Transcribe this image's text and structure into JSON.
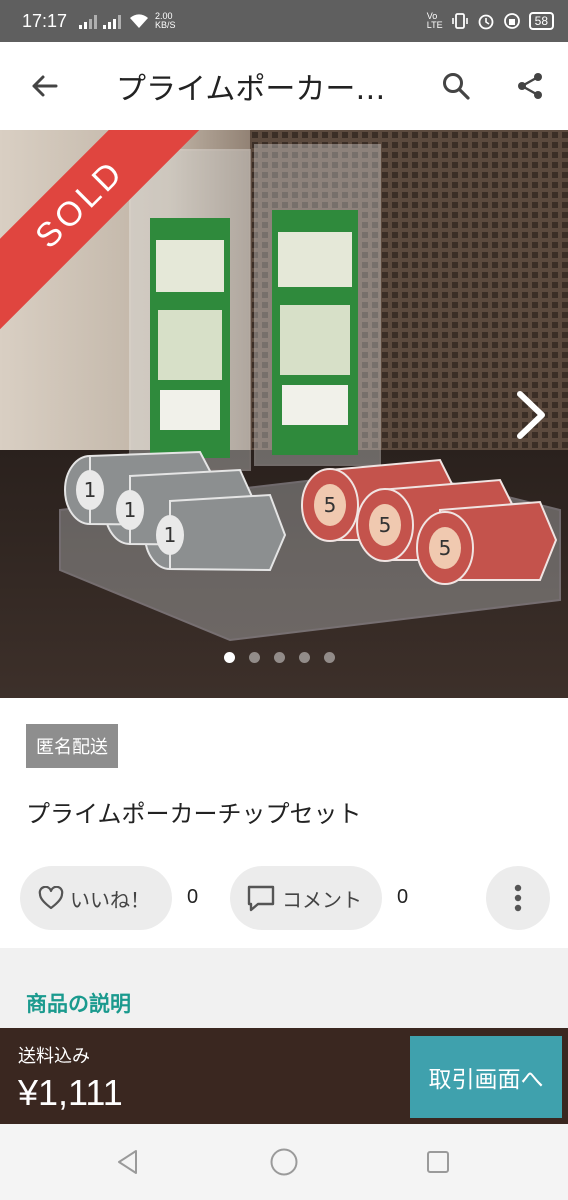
{
  "status_bar": {
    "time": "17:17",
    "net_speed_value": "2.00",
    "net_speed_unit": "KB/S",
    "volte_top": "Vo",
    "volte_bottom": "LTE",
    "battery": "58"
  },
  "header": {
    "title": "プライムポーカー…"
  },
  "photo": {
    "sold_label": "SOLD",
    "page_count": 5,
    "current_page": 1
  },
  "product": {
    "shipping_badge": "匿名配送",
    "title": "プライムポーカーチップセット",
    "like_label": "いいね！",
    "like_count": "0",
    "comment_label": "コメント",
    "comment_count": "0"
  },
  "description": {
    "heading": "商品の説明"
  },
  "purchase_bar": {
    "shipping_label": "送料込み",
    "price": "¥1,111",
    "button_label": "取引画面へ"
  },
  "colors": {
    "status_bar": "#5f5f5f",
    "sold_banner": "#e0453f",
    "accent_teal": "#1a9a8e",
    "buy_bar": "#3a2720",
    "trade_button": "#3fa1ad",
    "badge": "#8e8e8e"
  },
  "icons": {
    "back": "arrow-left-icon",
    "search": "search-icon",
    "share": "share-icon",
    "next": "chevron-right-icon",
    "like": "heart-icon",
    "comment": "comment-icon",
    "more": "more-vertical-icon",
    "nav_back": "triangle-back-icon",
    "nav_home": "circle-home-icon",
    "nav_recent": "square-recent-icon"
  }
}
